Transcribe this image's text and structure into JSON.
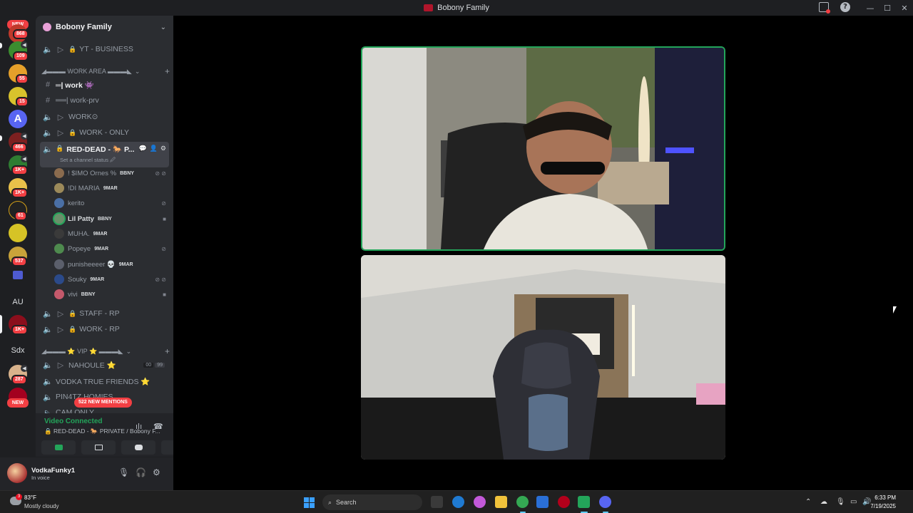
{
  "window": {
    "title": "Bobony Family"
  },
  "rail": {
    "new_top": "NEW",
    "badges": [
      "868",
      "109",
      "55",
      "15",
      "466",
      "1K+",
      "1K+",
      "61",
      "537",
      "1K+",
      "287"
    ],
    "au_label": "AU",
    "sdx_label": "Sdx",
    "new_bottom": "NEW"
  },
  "server": {
    "name": "Bobony Family"
  },
  "channels": {
    "yt_business": "YT - BUSINESS",
    "cat_work_area": "◢▬▬▬ WORK AREA ▬▬▬◣",
    "work": "═| work 👾",
    "work_prv": "══| work-prv",
    "work_o": "WORK⊙",
    "work_only": "WORK - ONLY",
    "red_dead": "RED-DEAD - 🐎 P...",
    "red_dead_status": "Set a channel status 🖉",
    "staff_rp": "STAFF - RP",
    "work_rp": "WORK - RP",
    "cat_vip": "◢▬▬▬ ⭐ VIP ⭐ ▬▬▬◣",
    "nahoule": "NAHOULE ⭐",
    "nahoule_counts": [
      "00",
      "99"
    ],
    "vodka_true_friends": "VODKA TRUE FRIENDS ⭐",
    "pin4t": "PIN4TZ HOMIES",
    "cam_only": "CAM ONLY"
  },
  "voice_users": [
    {
      "name": "! $IMO Ornes %",
      "tag": "BBNY"
    },
    {
      "name": "!DI MARIA",
      "tag": "9MAR"
    },
    {
      "name": "kerito",
      "tag": ""
    },
    {
      "name": "Lil Patty",
      "tag": "BBNY"
    },
    {
      "name": "MUHA.",
      "tag": "9MAR"
    },
    {
      "name": "Popeye",
      "tag": "9MAR"
    },
    {
      "name": "punisheeeer 💀",
      "tag": "9MAR"
    },
    {
      "name": "Souky",
      "tag": "9MAR"
    },
    {
      "name": "vivi",
      "tag": "BBNY"
    }
  ],
  "mentions": "522 NEW MENTIONS",
  "voice_panel": {
    "status": "Video Connected",
    "channel": "🔒 RED-DEAD - 🐎 PRIVATE / Bobony F..."
  },
  "user": {
    "name": "VodkaFunky1",
    "status": "In voice"
  },
  "taskbar": {
    "temperature": "83°F",
    "condition": "Mostly cloudy",
    "weather_badge": "3",
    "search_placeholder": "Search",
    "time": "6:33 PM",
    "date": "7/19/2025"
  },
  "colors": {
    "accent_green": "#23a55a",
    "badge_red": "#f23f43",
    "sidebar_bg": "#2b2d31"
  }
}
